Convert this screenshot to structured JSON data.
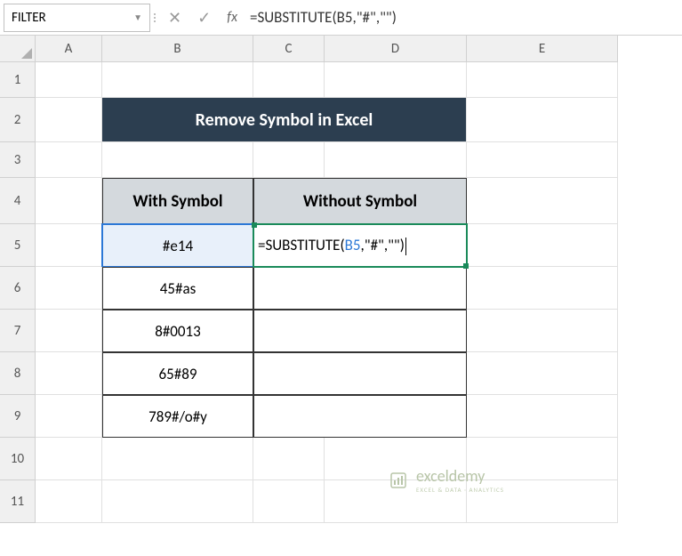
{
  "nameBox": {
    "value": "FILTER"
  },
  "formulaBar": {
    "cancel": "✕",
    "confirm": "✓",
    "fx": "fx",
    "formula": "=SUBSTITUTE(B5,\"#\",\"\")"
  },
  "columns": [
    "A",
    "B",
    "C",
    "D",
    "E"
  ],
  "rows": [
    "1",
    "2",
    "3",
    "4",
    "5",
    "6",
    "7",
    "8",
    "9",
    "10",
    "11"
  ],
  "title": "Remove Symbol in Excel",
  "headers": {
    "withSymbol": "With Symbol",
    "withoutSymbol": "Without Symbol"
  },
  "data": {
    "b5": "#e14",
    "b6": "45#as",
    "b7": "8#0013",
    "b8": "65#89",
    "b9": "789#/o#y"
  },
  "editCell": {
    "prefix": "=SUBSTITUTE(",
    "ref": "B5",
    "suffix": ",\"#\",\"\")"
  },
  "watermark": {
    "name": "exceldemy",
    "sub": "EXCEL & DATA · ANALYTICS"
  }
}
